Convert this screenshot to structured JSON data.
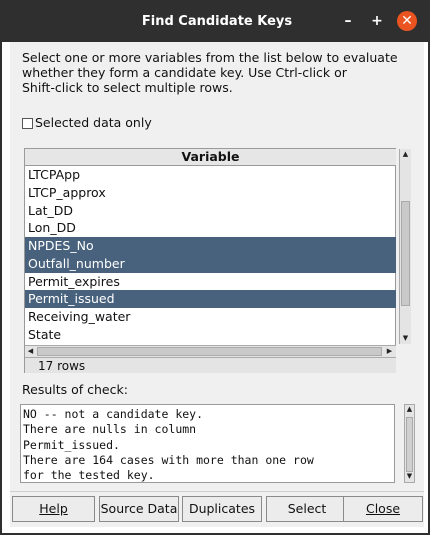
{
  "window": {
    "title": "Find Candidate Keys",
    "minimize_glyph": "–",
    "maximize_glyph": "+",
    "close_glyph": "✕",
    "close_color": "#e95420"
  },
  "instructions": "Select one or more variables from the list below to evaluate\nwhether they form a candidate key.  Use Ctrl-click or\nShift-click to select multiple rows.",
  "selected_data_only": {
    "label": "Selected data only",
    "checked": false
  },
  "variable_list": {
    "header": "Variable",
    "rows": [
      {
        "label": "LTCPApp",
        "selected": false
      },
      {
        "label": "LTCP_approx",
        "selected": false
      },
      {
        "label": "Lat_DD",
        "selected": false
      },
      {
        "label": "Lon_DD",
        "selected": false
      },
      {
        "label": "NPDES_No",
        "selected": true
      },
      {
        "label": "Outfall_number",
        "selected": true
      },
      {
        "label": "Permit_expires",
        "selected": false
      },
      {
        "label": "Permit_issued",
        "selected": true
      },
      {
        "label": "Receiving_water",
        "selected": false
      },
      {
        "label": "State",
        "selected": false
      }
    ],
    "row_count_text": "17 rows",
    "selection_color": "#48627d"
  },
  "results": {
    "label": "Results of check:",
    "text": "NO -- not a candidate key.\nThere are nulls in column\nPermit_issued.\nThere are 164 cases with more than one row\nfor the tested key."
  },
  "buttons": {
    "help": "Help",
    "source_data": "Source Data",
    "duplicates": "Duplicates",
    "select": "Select",
    "close": "Close"
  }
}
